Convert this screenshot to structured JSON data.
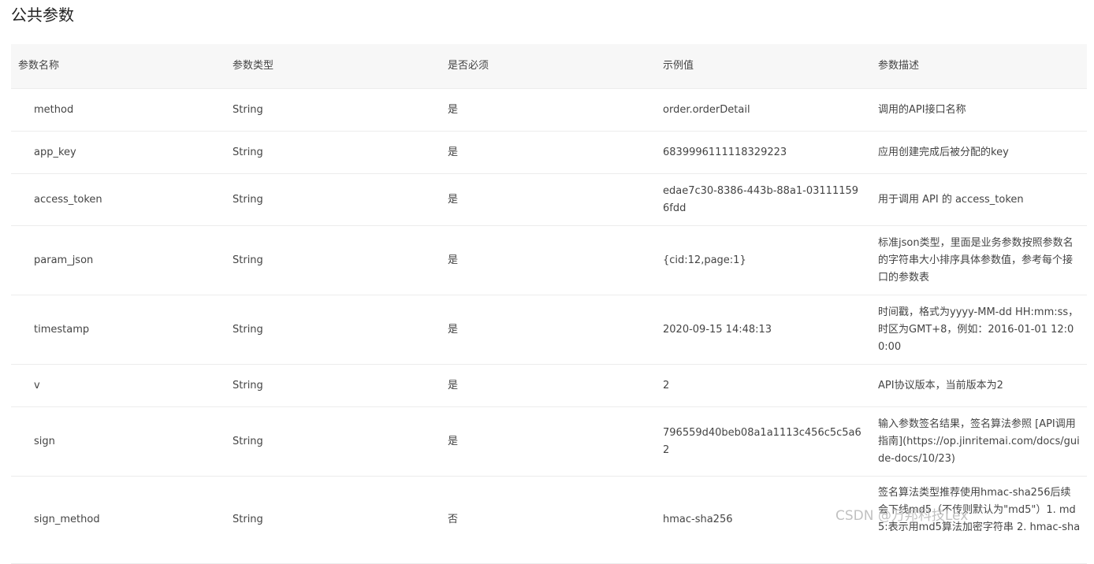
{
  "title": "公共参数",
  "headers": [
    "参数名称",
    "参数类型",
    "是否必须",
    "示例值",
    "参数描述"
  ],
  "rows": [
    {
      "name": "method",
      "type": "String",
      "required": "是",
      "example": "order.orderDetail",
      "desc": "调用的API接口名称"
    },
    {
      "name": "app_key",
      "type": "String",
      "required": "是",
      "example": "6839996111118329223",
      "desc": "应用创建完成后被分配的key"
    },
    {
      "name": "access_token",
      "type": "String",
      "required": "是",
      "example": "edae7c30-8386-443b-88a1-031111596fdd",
      "desc": "用于调用 API 的 access_token"
    },
    {
      "name": "param_json",
      "type": "String",
      "required": "是",
      "example": "{cid:12,page:1}",
      "desc": "标准json类型，里面是业务参数按照参数名的字符串大小排序具体参数值，参考每个接口的参数表"
    },
    {
      "name": "timestamp",
      "type": "String",
      "required": "是",
      "example": "2020-09-15 14:48:13",
      "desc": "时间戳，格式为yyyy-MM-dd HH:mm:ss，时区为GMT+8，例如：2016-01-01 12:00:00"
    },
    {
      "name": "v",
      "type": "String",
      "required": "是",
      "example": "2",
      "desc": "API协议版本，当前版本为2"
    },
    {
      "name": "sign",
      "type": "String",
      "required": "是",
      "example": "796559d40beb08a1a1113c456c5c5a62",
      "desc": "输入参数签名结果，签名算法参照 [API调用指南](https://op.jinritemai.com/docs/guide-docs/10/23)"
    },
    {
      "name": "sign_method",
      "type": "String",
      "required": "否",
      "example": "hmac-sha256",
      "desc": "签名算法类型推荐使用hmac-sha256后续会下线md5（不传则默认为\"md5\"）1. md5:表示用md5算法加密字符串 2. hmac-sha"
    }
  ],
  "watermark": "CSDN @万邦科技Lex"
}
